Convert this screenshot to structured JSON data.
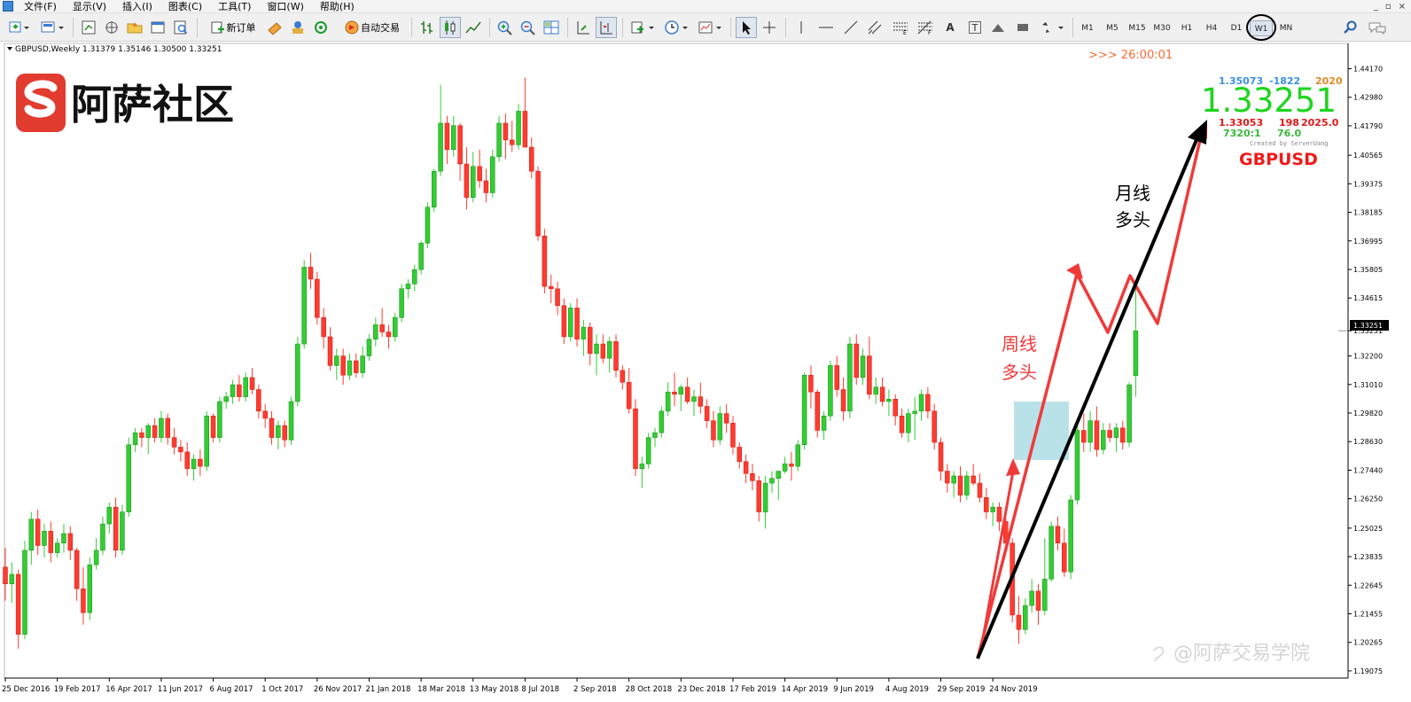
{
  "menu": [
    "文件(F)",
    "显示(V)",
    "插入(I)",
    "图表(C)",
    "工具(T)",
    "窗口(W)",
    "帮助(H)"
  ],
  "window_controls": [
    "_",
    "▫",
    "×"
  ],
  "toolbar": {
    "new_order_label": "新订单",
    "auto_trade_label": "自动交易",
    "line_tools": [
      "A",
      "T"
    ],
    "timeframes": [
      "M1",
      "M5",
      "M15",
      "M30",
      "H1",
      "H4",
      "D1",
      "W1",
      "MN"
    ],
    "active_timeframe": "W1"
  },
  "chart": {
    "header": "GBPUSD,Weekly  1.31379 1.35146 1.30500 1.33251",
    "watermark": "阿萨社区",
    "timer": ">>> 26:00:01",
    "info_line1": [
      "1.35073",
      "-1822",
      "2020"
    ],
    "big_price": "1.33251",
    "info_line2": [
      "1.33053",
      "198",
      "2025.0"
    ],
    "info_line3": [
      "7320:1",
      "76.0"
    ],
    "created_by": "Created by ServerUang",
    "symbol": "GBPUSD",
    "monthly_label": [
      "月线",
      "多头"
    ],
    "weekly_label": [
      "周线",
      "多头"
    ],
    "bottom_watermark": "@阿萨交易学院",
    "current_price_tag": "1.33251",
    "colors": {
      "bull": "#32cd32",
      "bear": "#ff3b30",
      "bull_border": "#1a8a1a",
      "bear_border": "#cc1a10",
      "arrow_red": "#f03a3a",
      "arrow_black": "#000000",
      "box": "#7fcad6"
    }
  },
  "chart_data": {
    "type": "candlestick",
    "symbol": "GBPUSD",
    "timeframe": "Weekly",
    "ylim": [
      1.1885,
      1.4515
    ],
    "y_ticks": [
      "1.44170",
      "1.42980",
      "1.41790",
      "1.40565",
      "1.39375",
      "1.38185",
      "1.36995",
      "1.35805",
      "1.34615",
      "1.33251",
      "1.32200",
      "1.31010",
      "1.29820",
      "1.28630",
      "1.27440",
      "1.26250",
      "1.25025",
      "1.23835",
      "1.22645",
      "1.21455",
      "1.20265",
      "1.19075"
    ],
    "x_labels": [
      "25 Dec 2016",
      "19 Feb 2017",
      "16 Apr 2017",
      "11 Jun 2017",
      "6 Aug 2017",
      "1 Oct 2017",
      "26 Nov 2017",
      "21 Jan 2018",
      "18 Mar 2018",
      "13 May 2018",
      "8 Jul 2018",
      "2 Sep 2018",
      "28 Oct 2018",
      "23 Dec 2018",
      "17 Feb 2019",
      "14 Apr 2019",
      "9 Jun 2019",
      "4 Aug 2019",
      "29 Sep 2019",
      "24 Nov 2019"
    ],
    "weeks_per_label": 8,
    "ohlc": [
      [
        1.234,
        1.242,
        1.22,
        1.227
      ],
      [
        1.227,
        1.236,
        1.219,
        1.231
      ],
      [
        1.231,
        1.233,
        1.2,
        1.206
      ],
      [
        1.206,
        1.245,
        1.204,
        1.241
      ],
      [
        1.241,
        1.257,
        1.235,
        1.254
      ],
      [
        1.254,
        1.258,
        1.239,
        1.243
      ],
      [
        1.243,
        1.252,
        1.238,
        1.249
      ],
      [
        1.249,
        1.253,
        1.236,
        1.24
      ],
      [
        1.24,
        1.246,
        1.238,
        1.244
      ],
      [
        1.244,
        1.252,
        1.24,
        1.248
      ],
      [
        1.248,
        1.251,
        1.237,
        1.241
      ],
      [
        1.241,
        1.242,
        1.22,
        1.225
      ],
      [
        1.225,
        1.234,
        1.21,
        1.215
      ],
      [
        1.215,
        1.238,
        1.212,
        1.235
      ],
      [
        1.235,
        1.246,
        1.233,
        1.241
      ],
      [
        1.241,
        1.255,
        1.239,
        1.252
      ],
      [
        1.252,
        1.261,
        1.248,
        1.259
      ],
      [
        1.259,
        1.263,
        1.238,
        1.241
      ],
      [
        1.241,
        1.26,
        1.239,
        1.257
      ],
      [
        1.257,
        1.288,
        1.255,
        1.285
      ],
      [
        1.285,
        1.292,
        1.282,
        1.29
      ],
      [
        1.29,
        1.292,
        1.284,
        1.288
      ],
      [
        1.288,
        1.294,
        1.281,
        1.293
      ],
      [
        1.293,
        1.296,
        1.286,
        1.288
      ],
      [
        1.288,
        1.299,
        1.286,
        1.296
      ],
      [
        1.296,
        1.298,
        1.285,
        1.288
      ],
      [
        1.288,
        1.292,
        1.281,
        1.284
      ],
      [
        1.284,
        1.287,
        1.278,
        1.282
      ],
      [
        1.282,
        1.286,
        1.272,
        1.275
      ],
      [
        1.275,
        1.281,
        1.27,
        1.279
      ],
      [
        1.279,
        1.283,
        1.272,
        1.276
      ],
      [
        1.276,
        1.299,
        1.274,
        1.297
      ],
      [
        1.297,
        1.298,
        1.286,
        1.288
      ],
      [
        1.288,
        1.305,
        1.286,
        1.303
      ],
      [
        1.303,
        1.307,
        1.3,
        1.305
      ],
      [
        1.305,
        1.312,
        1.302,
        1.31
      ],
      [
        1.31,
        1.314,
        1.303,
        1.305
      ],
      [
        1.305,
        1.315,
        1.303,
        1.313
      ],
      [
        1.313,
        1.317,
        1.306,
        1.308
      ],
      [
        1.308,
        1.31,
        1.296,
        1.299
      ],
      [
        1.299,
        1.302,
        1.292,
        1.296
      ],
      [
        1.296,
        1.299,
        1.285,
        1.288
      ],
      [
        1.288,
        1.295,
        1.283,
        1.293
      ],
      [
        1.293,
        1.295,
        1.284,
        1.287
      ],
      [
        1.287,
        1.305,
        1.285,
        1.303
      ],
      [
        1.303,
        1.33,
        1.301,
        1.327
      ],
      [
        1.327,
        1.362,
        1.325,
        1.359
      ],
      [
        1.359,
        1.365,
        1.35,
        1.354
      ],
      [
        1.354,
        1.357,
        1.335,
        1.338
      ],
      [
        1.338,
        1.342,
        1.325,
        1.33
      ],
      [
        1.33,
        1.334,
        1.316,
        1.318
      ],
      [
        1.318,
        1.325,
        1.312,
        1.322
      ],
      [
        1.322,
        1.325,
        1.31,
        1.314
      ],
      [
        1.314,
        1.323,
        1.312,
        1.32
      ],
      [
        1.32,
        1.323,
        1.313,
        1.315
      ],
      [
        1.315,
        1.326,
        1.313,
        1.322
      ],
      [
        1.322,
        1.331,
        1.32,
        1.329
      ],
      [
        1.329,
        1.338,
        1.326,
        1.335
      ],
      [
        1.335,
        1.342,
        1.33,
        1.332
      ],
      [
        1.332,
        1.335,
        1.325,
        1.33
      ],
      [
        1.33,
        1.34,
        1.328,
        1.338
      ],
      [
        1.338,
        1.352,
        1.336,
        1.35
      ],
      [
        1.35,
        1.354,
        1.346,
        1.352
      ],
      [
        1.352,
        1.36,
        1.349,
        1.358
      ],
      [
        1.358,
        1.37,
        1.356,
        1.369
      ],
      [
        1.369,
        1.386,
        1.367,
        1.384
      ],
      [
        1.384,
        1.4,
        1.382,
        1.399
      ],
      [
        1.399,
        1.435,
        1.397,
        1.419
      ],
      [
        1.419,
        1.422,
        1.402,
        1.408
      ],
      [
        1.408,
        1.422,
        1.405,
        1.418
      ],
      [
        1.418,
        1.419,
        1.395,
        1.402
      ],
      [
        1.402,
        1.409,
        1.383,
        1.388
      ],
      [
        1.388,
        1.407,
        1.386,
        1.401
      ],
      [
        1.401,
        1.408,
        1.392,
        1.395
      ],
      [
        1.395,
        1.4,
        1.386,
        1.39
      ],
      [
        1.39,
        1.408,
        1.388,
        1.405
      ],
      [
        1.405,
        1.422,
        1.403,
        1.419
      ],
      [
        1.419,
        1.423,
        1.404,
        1.412
      ],
      [
        1.412,
        1.42,
        1.407,
        1.41
      ],
      [
        1.41,
        1.427,
        1.408,
        1.424
      ],
      [
        1.424,
        1.438,
        1.42,
        1.409
      ],
      [
        1.409,
        1.413,
        1.396,
        1.399
      ],
      [
        1.399,
        1.401,
        1.37,
        1.372
      ],
      [
        1.372,
        1.375,
        1.348,
        1.351
      ],
      [
        1.351,
        1.356,
        1.344,
        1.35
      ],
      [
        1.35,
        1.353,
        1.339,
        1.343
      ],
      [
        1.343,
        1.346,
        1.327,
        1.33
      ],
      [
        1.33,
        1.344,
        1.328,
        1.342
      ],
      [
        1.342,
        1.346,
        1.326,
        1.329
      ],
      [
        1.329,
        1.337,
        1.322,
        1.334
      ],
      [
        1.334,
        1.336,
        1.318,
        1.323
      ],
      [
        1.323,
        1.331,
        1.314,
        1.327
      ],
      [
        1.327,
        1.331,
        1.319,
        1.321
      ],
      [
        1.321,
        1.33,
        1.315,
        1.328
      ],
      [
        1.328,
        1.331,
        1.313,
        1.316
      ],
      [
        1.316,
        1.318,
        1.308,
        1.311
      ],
      [
        1.311,
        1.317,
        1.298,
        1.3
      ],
      [
        1.3,
        1.304,
        1.272,
        1.275
      ],
      [
        1.275,
        1.28,
        1.267,
        1.277
      ],
      [
        1.277,
        1.29,
        1.275,
        1.288
      ],
      [
        1.288,
        1.292,
        1.284,
        1.29
      ],
      [
        1.29,
        1.301,
        1.288,
        1.299
      ],
      [
        1.299,
        1.311,
        1.297,
        1.307
      ],
      [
        1.307,
        1.315,
        1.301,
        1.306
      ],
      [
        1.306,
        1.31,
        1.299,
        1.309
      ],
      [
        1.309,
        1.313,
        1.302,
        1.303
      ],
      [
        1.303,
        1.308,
        1.297,
        1.305
      ],
      [
        1.305,
        1.311,
        1.298,
        1.301
      ],
      [
        1.301,
        1.304,
        1.292,
        1.295
      ],
      [
        1.295,
        1.299,
        1.284,
        1.287
      ],
      [
        1.287,
        1.301,
        1.285,
        1.298
      ],
      [
        1.298,
        1.302,
        1.29,
        1.294
      ],
      [
        1.294,
        1.297,
        1.281,
        1.284
      ],
      [
        1.284,
        1.286,
        1.275,
        1.278
      ],
      [
        1.278,
        1.281,
        1.269,
        1.273
      ],
      [
        1.273,
        1.277,
        1.266,
        1.27
      ],
      [
        1.27,
        1.272,
        1.253,
        1.257
      ],
      [
        1.257,
        1.272,
        1.25,
        1.269
      ],
      [
        1.269,
        1.274,
        1.265,
        1.271
      ],
      [
        1.271,
        1.274,
        1.262,
        1.274
      ],
      [
        1.274,
        1.28,
        1.273,
        1.277
      ],
      [
        1.277,
        1.282,
        1.27,
        1.276
      ],
      [
        1.276,
        1.287,
        1.274,
        1.285
      ],
      [
        1.285,
        1.315,
        1.283,
        1.314
      ],
      [
        1.314,
        1.318,
        1.3,
        1.307
      ],
      [
        1.307,
        1.308,
        1.288,
        1.291
      ],
      [
        1.291,
        1.299,
        1.287,
        1.297
      ],
      [
        1.297,
        1.32,
        1.295,
        1.318
      ],
      [
        1.318,
        1.322,
        1.305,
        1.308
      ],
      [
        1.308,
        1.313,
        1.295,
        1.299
      ],
      [
        1.299,
        1.33,
        1.296,
        1.327
      ],
      [
        1.327,
        1.331,
        1.31,
        1.313
      ],
      [
        1.313,
        1.325,
        1.31,
        1.322
      ],
      [
        1.322,
        1.33,
        1.304,
        1.306
      ],
      [
        1.306,
        1.313,
        1.302,
        1.309
      ],
      [
        1.309,
        1.313,
        1.301,
        1.303
      ],
      [
        1.303,
        1.308,
        1.297,
        1.304
      ],
      [
        1.304,
        1.306,
        1.293,
        1.297
      ],
      [
        1.297,
        1.3,
        1.288,
        1.29
      ],
      [
        1.29,
        1.3,
        1.286,
        1.298
      ],
      [
        1.298,
        1.305,
        1.287,
        1.299
      ],
      [
        1.299,
        1.308,
        1.295,
        1.306
      ],
      [
        1.306,
        1.309,
        1.296,
        1.299
      ],
      [
        1.299,
        1.302,
        1.283,
        1.286
      ],
      [
        1.286,
        1.288,
        1.27,
        1.274
      ],
      [
        1.274,
        1.277,
        1.265,
        1.269
      ],
      [
        1.269,
        1.274,
        1.263,
        1.272
      ],
      [
        1.272,
        1.276,
        1.261,
        1.264
      ],
      [
        1.264,
        1.274,
        1.262,
        1.272
      ],
      [
        1.272,
        1.277,
        1.268,
        1.269
      ],
      [
        1.269,
        1.273,
        1.261,
        1.263
      ],
      [
        1.263,
        1.267,
        1.254,
        1.257
      ],
      [
        1.257,
        1.261,
        1.251,
        1.259
      ],
      [
        1.259,
        1.261,
        1.249,
        1.253
      ],
      [
        1.253,
        1.256,
        1.241,
        1.244
      ],
      [
        1.244,
        1.246,
        1.211,
        1.214
      ],
      [
        1.214,
        1.222,
        1.202,
        1.208
      ],
      [
        1.208,
        1.221,
        1.206,
        1.218
      ],
      [
        1.218,
        1.229,
        1.215,
        1.224
      ],
      [
        1.224,
        1.227,
        1.21,
        1.216
      ],
      [
        1.216,
        1.246,
        1.214,
        1.229
      ],
      [
        1.229,
        1.253,
        1.228,
        1.251
      ],
      [
        1.251,
        1.255,
        1.241,
        1.244
      ],
      [
        1.244,
        1.25,
        1.23,
        1.232
      ],
      [
        1.232,
        1.264,
        1.229,
        1.262
      ],
      [
        1.262,
        1.296,
        1.26,
        1.291
      ],
      [
        1.291,
        1.298,
        1.282,
        1.286
      ],
      [
        1.286,
        1.299,
        1.282,
        1.295
      ],
      [
        1.295,
        1.301,
        1.28,
        1.283
      ],
      [
        1.283,
        1.294,
        1.281,
        1.291
      ],
      [
        1.291,
        1.294,
        1.286,
        1.288
      ],
      [
        1.288,
        1.294,
        1.282,
        1.292
      ],
      [
        1.292,
        1.295,
        1.283,
        1.286
      ],
      [
        1.286,
        1.311,
        1.284,
        1.31
      ],
      [
        1.3138,
        1.3515,
        1.305,
        1.3325
      ]
    ]
  }
}
